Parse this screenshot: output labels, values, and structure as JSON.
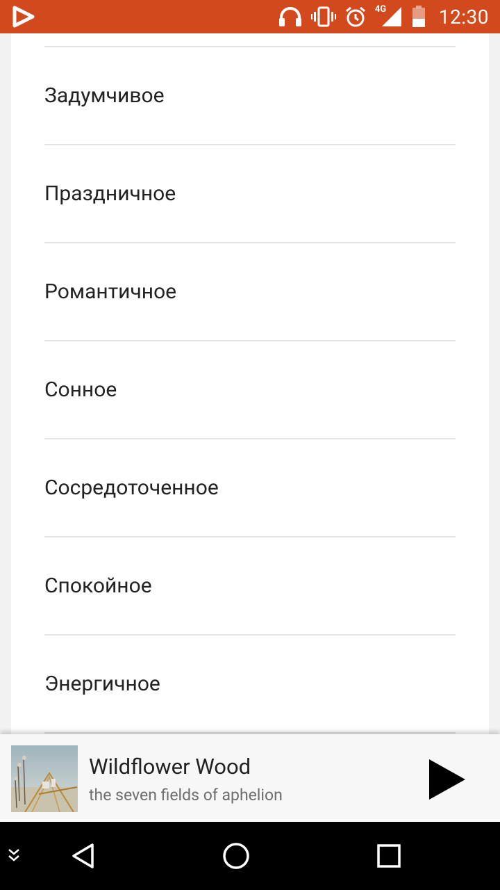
{
  "status_bar": {
    "time": "12:30",
    "network_label": "4G",
    "color": "#d2491e",
    "icons": [
      "app-logo-icon",
      "headphones-icon",
      "vibrate-icon",
      "alarm-icon",
      "signal-4g-icon",
      "battery-low-icon"
    ]
  },
  "moods": [
    {
      "label": "Задумчивое"
    },
    {
      "label": "Праздничное"
    },
    {
      "label": "Романтичное"
    },
    {
      "label": "Сонное"
    },
    {
      "label": "Сосредоточенное"
    },
    {
      "label": "Спокойное"
    },
    {
      "label": "Энергичное"
    }
  ],
  "player": {
    "track_title": "Wildflower Wood",
    "track_artist": "the seven fields of aphelion",
    "icons": [
      "album-art",
      "play-icon"
    ]
  },
  "nav_bar": {
    "icons": [
      "collapse-icon",
      "back-icon",
      "home-icon",
      "recents-icon"
    ]
  }
}
